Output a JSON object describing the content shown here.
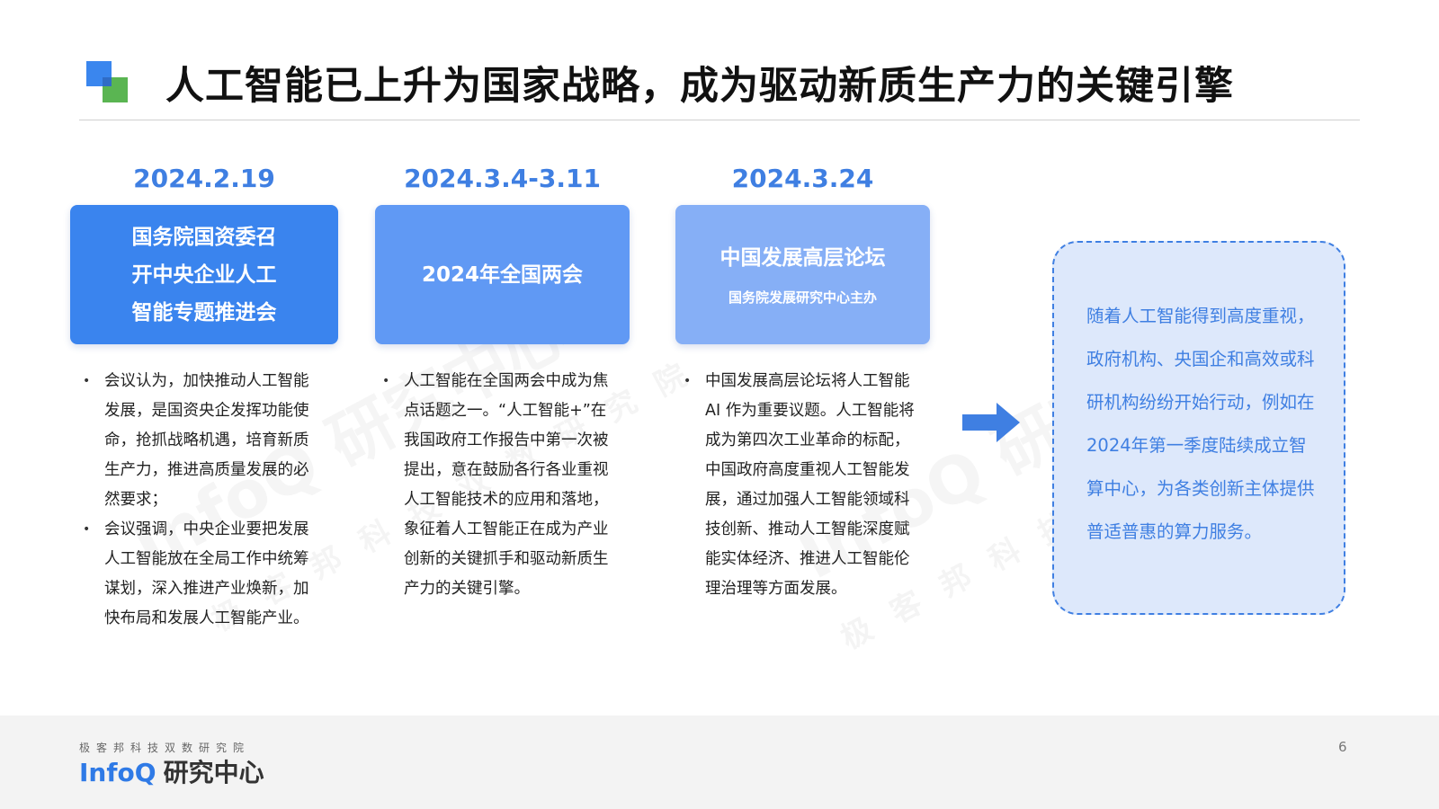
{
  "title": "人工智能已上升为国家战略，成为驱动新质生产力的关键引擎",
  "events": [
    {
      "date": "2024.2.19",
      "box_lines": [
        "国务院国资委召",
        "开中央企业人工",
        "智能专题推进会"
      ],
      "bullets": [
        "会议认为，加快推动人工智能发展，是国资央企发挥功能使命，抢抓战略机遇，培育新质生产力，推进高质量发展的必然要求；",
        "会议强调，中央企业要把发展人工智能放在全局工作中统筹谋划，深入推进产业焕新，加快布局和发展人工智能产业。"
      ]
    },
    {
      "date": "2024.3.4-3.11",
      "box_title": "2024年全国两会",
      "bullets": [
        "人工智能在全国两会中成为焦点话题之一。“人工智能+”在我国政府工作报告中第一次被提出，意在鼓励各行各业重视人工智能技术的应用和落地，象征着人工智能正在成为产业创新的关键抓手和驱动新质生产力的关键引擎。"
      ]
    },
    {
      "date": "2024.3.24",
      "box_title": "中国发展高层论坛",
      "box_subtitle": "国务院发展研究中心主办",
      "bullets": [
        "中国发展高层论坛将人工智能 AI 作为重要议题。人工智能将成为第四次工业革命的标配，中国政府高度重视人工智能发展，通过加强人工智能领域科技创新、推动人工智能深度赋能实体经济、推进人工智能伦理治理等方面发展。"
      ]
    }
  ],
  "summary": "随着人工智能得到高度重视，政府机构、央国企和高效或科研机构纷纷开始行动，例如在2024年第一季度陆续成立智算中心，为各类创新主体提供普适普惠的算力服务。",
  "footer": {
    "org_subtitle": "极客邦科技双数研究院",
    "logo_info": "InfoQ",
    "logo_cn": "研究中心",
    "page_number": "6"
  },
  "colors": {
    "accent_blue": "#3f7fe2",
    "box1": "#3a84ee",
    "box2": "#6099f4",
    "box3": "#86aff6",
    "summary_bg": "#dde8fb"
  },
  "icons": {
    "arrow": "arrow-right-icon",
    "logo": "squares-logo-icon"
  }
}
